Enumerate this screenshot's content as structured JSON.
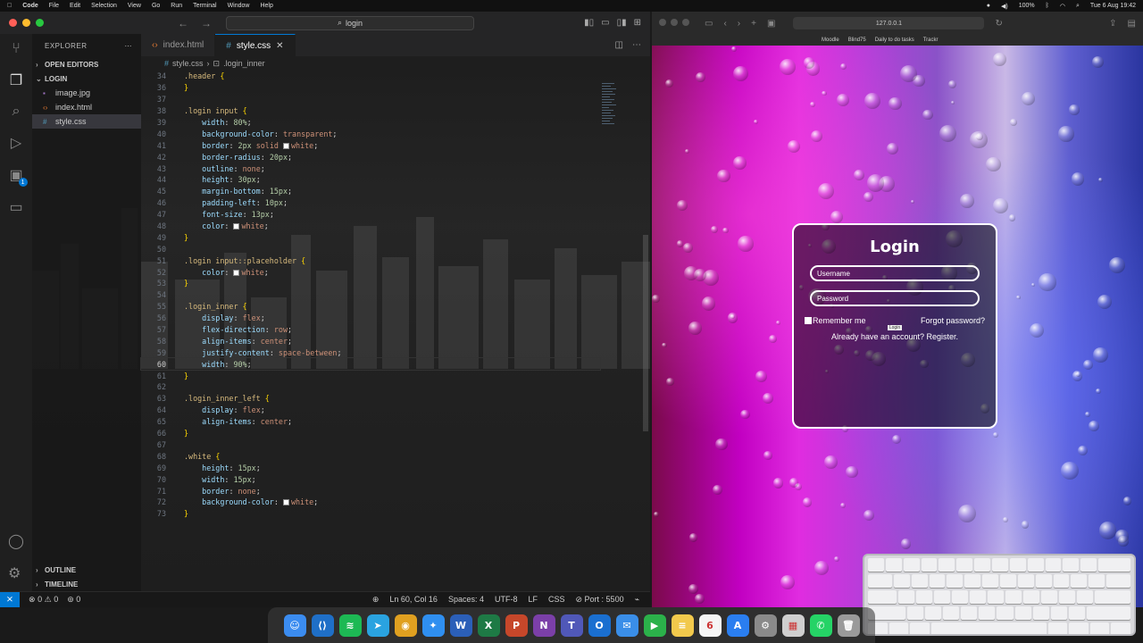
{
  "menubar": {
    "items": [
      "Code",
      "File",
      "Edit",
      "Selection",
      "View",
      "Go",
      "Run",
      "Terminal",
      "Window",
      "Help"
    ],
    "battery": "100%",
    "datetime": "Tue 6 Aug  19:42"
  },
  "vscode": {
    "search_text": "login",
    "explorer_title": "EXPLORER",
    "open_editors": "OPEN EDITORS",
    "folder": "LOGIN",
    "files": [
      "image.jpg",
      "index.html",
      "style.css"
    ],
    "outline": "OUTLINE",
    "timeline": "TIMELINE",
    "extensions_badge": "1",
    "tabs": [
      {
        "label": "index.html",
        "active": false
      },
      {
        "label": "style.css",
        "active": true
      }
    ],
    "breadcrumb": [
      "style.css",
      ".login_inner"
    ],
    "status": {
      "errors": "0",
      "warnings": "0",
      "ports": "0",
      "position": "Ln 60, Col 16",
      "spaces": "Spaces: 4",
      "encoding": "UTF-8",
      "eol": "LF",
      "language": "CSS",
      "port": "Port : 5500"
    },
    "current_line": 60,
    "lines": [
      {
        "n": "34",
        "html": "<span class='sel'>.header</span> <span class='brace'>{</span>"
      },
      {
        "n": "36",
        "html": "<span class='brace'>}</span>"
      },
      {
        "n": "37",
        "html": ""
      },
      {
        "n": "38",
        "html": "<span class='sel'>.login input</span> <span class='brace'>{</span>"
      },
      {
        "n": "39",
        "html": "    <span class='prop'>width</span>: <span class='num'>80%</span>;"
      },
      {
        "n": "40",
        "html": "    <span class='prop'>background-color</span>: <span class='val'>transparent</span>;"
      },
      {
        "n": "41",
        "html": "    <span class='prop'>border</span>: <span class='num'>2px</span> <span class='val'>solid</span> <span class='sw'></span><span class='val'>white</span>;"
      },
      {
        "n": "42",
        "html": "    <span class='prop'>border-radius</span>: <span class='num'>20px</span>;"
      },
      {
        "n": "43",
        "html": "    <span class='prop'>outline</span>: <span class='val'>none</span>;"
      },
      {
        "n": "44",
        "html": "    <span class='prop'>height</span>: <span class='num'>30px</span>;"
      },
      {
        "n": "45",
        "html": "    <span class='prop'>margin-bottom</span>: <span class='num'>15px</span>;"
      },
      {
        "n": "46",
        "html": "    <span class='prop'>padding-left</span>: <span class='num'>10px</span>;"
      },
      {
        "n": "47",
        "html": "    <span class='prop'>font-size</span>: <span class='num'>13px</span>;"
      },
      {
        "n": "48",
        "html": "    <span class='prop'>color</span>: <span class='sw'></span><span class='val'>white</span>;"
      },
      {
        "n": "49",
        "html": "<span class='brace'>}</span>"
      },
      {
        "n": "50",
        "html": ""
      },
      {
        "n": "51",
        "html": "<span class='sel'>.login input::placeholder</span> <span class='brace'>{</span>"
      },
      {
        "n": "52",
        "html": "    <span class='prop'>color</span>: <span class='sw'></span><span class='val'>white</span>;"
      },
      {
        "n": "53",
        "html": "<span class='brace'>}</span>"
      },
      {
        "n": "54",
        "html": ""
      },
      {
        "n": "55",
        "html": "<span class='sel'>.login_inner</span> <span class='brace'>{</span>"
      },
      {
        "n": "56",
        "html": "    <span class='prop'>display</span>: <span class='val'>flex</span>;"
      },
      {
        "n": "57",
        "html": "    <span class='prop'>flex-direction</span>: <span class='val'>row</span>;"
      },
      {
        "n": "58",
        "html": "    <span class='prop'>align-items</span>: <span class='val'>center</span>;"
      },
      {
        "n": "59",
        "html": "    <span class='prop'>justify-content</span>: <span class='val'>space-between</span>;"
      },
      {
        "n": "60",
        "html": "    <span class='prop'>width</span>: <span class='num'>90%</span>;"
      },
      {
        "n": "61",
        "html": "<span class='brace'>}</span>"
      },
      {
        "n": "62",
        "html": ""
      },
      {
        "n": "63",
        "html": "<span class='sel'>.login_inner_left</span> <span class='brace'>{</span>"
      },
      {
        "n": "64",
        "html": "    <span class='prop'>display</span>: <span class='val'>flex</span>;"
      },
      {
        "n": "65",
        "html": "    <span class='prop'>align-items</span>: <span class='val'>center</span>;"
      },
      {
        "n": "66",
        "html": "<span class='brace'>}</span>"
      },
      {
        "n": "67",
        "html": ""
      },
      {
        "n": "68",
        "html": "<span class='sel'>.white</span> <span class='brace'>{</span>"
      },
      {
        "n": "69",
        "html": "    <span class='prop'>height</span>: <span class='num'>15px</span>;"
      },
      {
        "n": "70",
        "html": "    <span class='prop'>width</span>: <span class='num'>15px</span>;"
      },
      {
        "n": "71",
        "html": "    <span class='prop'>border</span>: <span class='val'>none</span>;"
      },
      {
        "n": "72",
        "html": "    <span class='prop'>background-color</span>: <span class='sw'></span><span class='val'>white</span>;"
      },
      {
        "n": "73",
        "html": "<span class='brace'>}</span>"
      }
    ]
  },
  "browser": {
    "address": "127.0.0.1",
    "bookmarks": [
      "Moodle",
      "Blind75",
      "Daily to do tasks",
      "Trackr"
    ],
    "login": {
      "title": "Login",
      "username_placeholder": "Username",
      "password_placeholder": "Password",
      "remember": "Remember me",
      "forgot": "Forgot password?",
      "tooltip": "Login",
      "register": "Already have an account? Register."
    }
  },
  "dock": {
    "apps": [
      {
        "name": "finder-icon",
        "color": "#3b8cf0",
        "glyph": "☺"
      },
      {
        "name": "vscode-icon",
        "color": "#1f6fc7",
        "glyph": "⟨⟩"
      },
      {
        "name": "spotify-icon",
        "color": "#1db954",
        "glyph": "≋"
      },
      {
        "name": "telegram-icon",
        "color": "#2aa3e0",
        "glyph": "➤"
      },
      {
        "name": "chrome-icon",
        "color": "#e0a020",
        "glyph": "◉"
      },
      {
        "name": "safari-icon",
        "color": "#2f8ff0",
        "glyph": "✦"
      },
      {
        "name": "word-icon",
        "color": "#2b5fb8",
        "glyph": "W"
      },
      {
        "name": "excel-icon",
        "color": "#1e7a45",
        "glyph": "X"
      },
      {
        "name": "powerpoint-icon",
        "color": "#c6472a",
        "glyph": "P"
      },
      {
        "name": "onenote-icon",
        "color": "#7b3fa8",
        "glyph": "N"
      },
      {
        "name": "teams-icon",
        "color": "#5058b8",
        "glyph": "T"
      },
      {
        "name": "outlook-icon",
        "color": "#1a6fd0",
        "glyph": "O"
      },
      {
        "name": "mail-icon",
        "color": "#3a8ee8",
        "glyph": "✉"
      },
      {
        "name": "facetime-icon",
        "color": "#2bb14a",
        "glyph": "▶"
      },
      {
        "name": "notes-icon",
        "color": "#f2c94c",
        "glyph": "≡"
      },
      {
        "name": "calendar-icon",
        "color": "#f5f5f5",
        "glyph": "6"
      },
      {
        "name": "app-store-icon",
        "color": "#2a7ef0",
        "glyph": "A"
      },
      {
        "name": "settings-icon",
        "color": "#8a8a8a",
        "glyph": "⚙"
      },
      {
        "name": "launchpad-icon",
        "color": "#cfcfcf",
        "glyph": "▦"
      },
      {
        "name": "whatsapp-icon",
        "color": "#25d366",
        "glyph": "✆"
      },
      {
        "name": "trash-icon",
        "color": "#9a9a9a",
        "glyph": "🗑"
      }
    ]
  }
}
